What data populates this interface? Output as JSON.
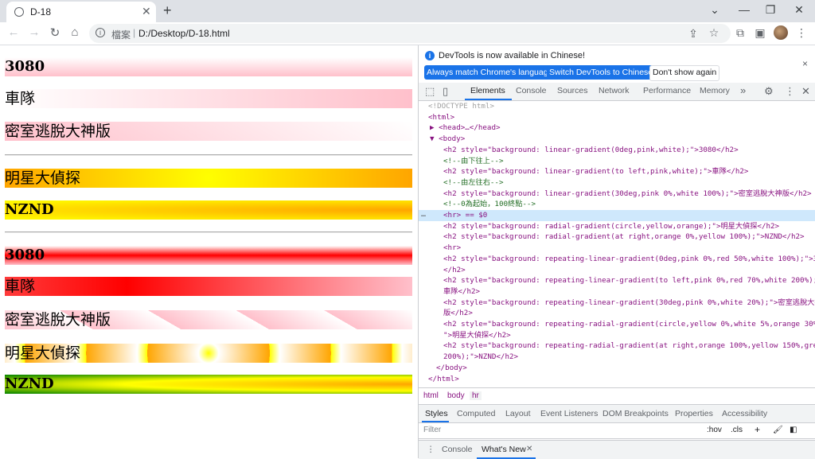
{
  "browser": {
    "tab_title": "D-18",
    "tab_close": "✕",
    "new_tab": "+",
    "window": {
      "minimize": "⌄",
      "min": "—",
      "restore": "❐",
      "close": "✕"
    },
    "nav": {
      "back": "←",
      "forward": "→",
      "reload": "↻",
      "home": "⌂"
    },
    "omnibox": {
      "info": "i",
      "scheme": "檔案",
      "separator": "|",
      "url": "D:/Desktop/D-18.html"
    },
    "icons": {
      "share": "⇪",
      "bookmark": "☆",
      "extensions": "⧉",
      "sidepanel": "▣",
      "menu": "⋮"
    }
  },
  "page": {
    "headings": [
      {
        "text": "3080",
        "background": "linear-gradient(0deg,pink,white)"
      },
      {
        "text": "車隊",
        "background": "linear-gradient(to left,pink,white)"
      },
      {
        "text": "密室逃脫大神版",
        "background": "linear-gradient(30deg,pink 0%,white 100%)"
      },
      {
        "text": "明星大偵探",
        "background": "radial-gradient(circle,yellow,orange)"
      },
      {
        "text": "NZND",
        "background": "radial-gradient(at right,orange 0%,yellow 100%)"
      },
      {
        "text": "3080",
        "background": "repeating-linear-gradient(0deg,pink 0%,red 50%,white 100%)"
      },
      {
        "text": "車隊",
        "background": "repeating-linear-gradient(to left,pink 0%,red 70%,white 200%)"
      },
      {
        "text": "密室逃脫大神版",
        "background": "repeating-linear-gradient(30deg,pink 0%,white 20%)"
      },
      {
        "text": "明星大偵探",
        "background": "repeating-radial-gradient(circle,yellow 0%,white 5%,orange 30%)"
      },
      {
        "text": "NZND",
        "background": "repeating-radial-gradient(at right,orange 100%,yellow 150%,green 200%)"
      }
    ]
  },
  "devtools": {
    "info_message": "DevTools is now available in Chinese!",
    "info_icon": "i",
    "btn_match": "Always match Chrome's language",
    "btn_switch": "Switch DevTools to Chinese",
    "btn_dont": "Don't show again",
    "close": "×",
    "tabs": [
      "Elements",
      "Console",
      "Sources",
      "Network",
      "Performance",
      "Memory"
    ],
    "more_tabs": "»",
    "icons": {
      "inspect": "⬚",
      "device": "▯",
      "settings": "⚙",
      "menu": "⋮",
      "close": "✕"
    },
    "dom": [
      {
        "text": "<!DOCTYPE html>",
        "cls": "gray",
        "indent": 12
      },
      {
        "text": "<html>",
        "cls": "tag",
        "indent": 12
      },
      {
        "text": "▶ <head>…</head>",
        "cls": "tag",
        "indent": 14
      },
      {
        "text": "▼ <body>",
        "cls": "tag",
        "indent": 14
      },
      {
        "text": "<h2 style=\"background: linear-gradient(0deg,pink,white);\">3080</h2>",
        "cls": "tag",
        "indent": 31
      },
      {
        "text": "<!--由下往上-->",
        "cls": "cm",
        "indent": 31
      },
      {
        "text": "<h2 style=\"background: linear-gradient(to left,pink,white);\">車隊</h2>",
        "cls": "tag",
        "indent": 31
      },
      {
        "text": "<!--由左往右-->",
        "cls": "cm",
        "indent": 31
      },
      {
        "text": "<h2 style=\"background: linear-gradient(30deg,pink 0%,white 100%);\">密室逃脫大神版</h2>",
        "cls": "tag",
        "indent": 31
      },
      {
        "text": "<!--0為起始，100終點-->",
        "cls": "cm",
        "indent": 31
      },
      {
        "text": "<hr> == $0",
        "cls": "tag",
        "indent": 31,
        "selected": true
      },
      {
        "text": "<h2 style=\"background: radial-gradient(circle,yellow,orange);\">明星大偵探</h2>",
        "cls": "tag",
        "indent": 31
      },
      {
        "text": "<h2 style=\"background: radial-gradient(at right,orange 0%,yellow 100%);\">NZND</h2>",
        "cls": "tag",
        "indent": 31
      },
      {
        "text": "<hr>",
        "cls": "tag",
        "indent": 31
      },
      {
        "text": "<h2 style=\"background: repeating-linear-gradient(0deg,pink 0%,red 50%,white 100%);\">3080",
        "cls": "tag",
        "indent": 31
      },
      {
        "text": "</h2>",
        "cls": "tag",
        "indent": 31
      },
      {
        "text": "<h2 style=\"background: repeating-linear-gradient(to left,pink 0%,red 70%,white 200%);\">",
        "cls": "tag",
        "indent": 31
      },
      {
        "text": "車隊</h2>",
        "cls": "tag",
        "indent": 31
      },
      {
        "text": "<h2 style=\"background: repeating-linear-gradient(30deg,pink 0%,white 20%);\">密室逃脫大神",
        "cls": "tag",
        "indent": 31
      },
      {
        "text": "版</h2>",
        "cls": "tag",
        "indent": 31
      },
      {
        "text": "<h2 style=\"background: repeating-radial-gradient(circle,yellow 0%,white 5%,orange 30%);",
        "cls": "tag",
        "indent": 31
      },
      {
        "text": "\">明星大偵探</h2>",
        "cls": "tag",
        "indent": 31
      },
      {
        "text": "<h2 style=\"background: repeating-radial-gradient(at right,orange 100%,yellow 150%,green",
        "cls": "tag",
        "indent": 31
      },
      {
        "text": "200%);\">NZND</h2>",
        "cls": "tag",
        "indent": 31
      },
      {
        "text": "</body>",
        "cls": "tag",
        "indent": 22
      },
      {
        "text": "</html>",
        "cls": "tag",
        "indent": 12
      }
    ],
    "ellipsis": "…",
    "breadcrumbs": [
      "html",
      "body",
      "hr"
    ],
    "subtabs": [
      "Styles",
      "Computed",
      "Layout",
      "Event Listeners",
      "DOM Breakpoints",
      "Properties",
      "Accessibility"
    ],
    "filter_placeholder": "Filter",
    "filter_hov": ":hov",
    "filter_cls": ".cls",
    "filter_plus": "+",
    "drawer_menu": "⋮",
    "drawer_tabs": [
      "Console",
      "What's New"
    ],
    "drawer_close": "✕"
  }
}
